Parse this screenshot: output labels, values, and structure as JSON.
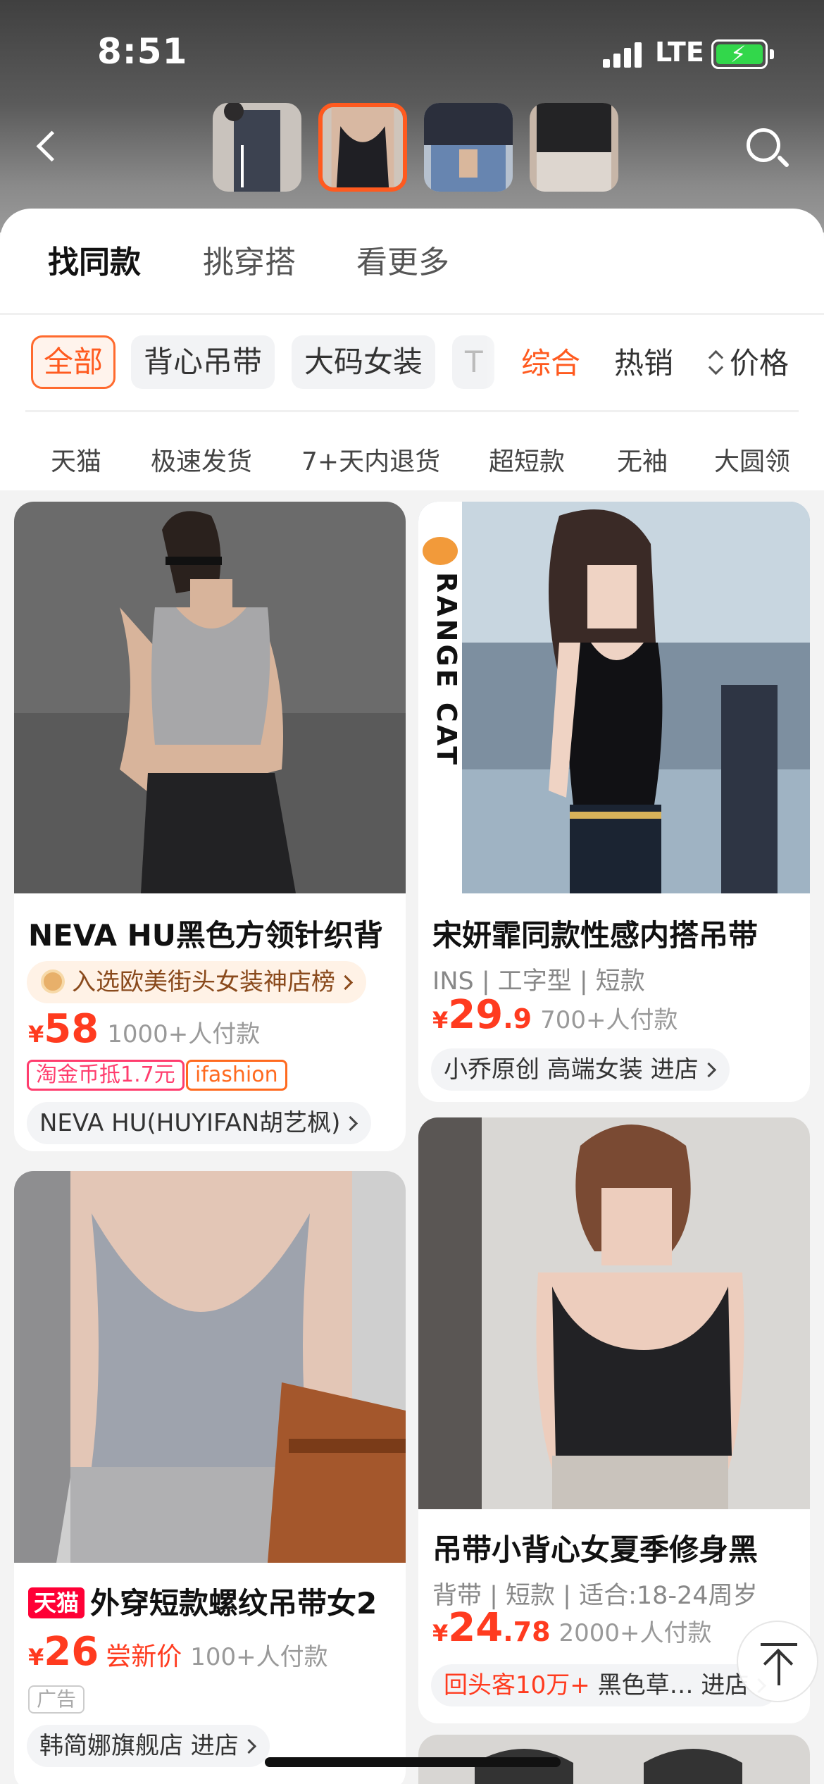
{
  "status_bar": {
    "time": "8:51",
    "network": "LTE"
  },
  "header_tabs": [
    {
      "label": "找同款",
      "active": true
    },
    {
      "label": "挑穿搭",
      "active": false
    },
    {
      "label": "看更多",
      "active": false
    }
  ],
  "category_chips": [
    {
      "label": "全部",
      "selected": true
    },
    {
      "label": "背心吊带",
      "selected": false
    },
    {
      "label": "大码女装",
      "selected": false
    },
    {
      "label": "T",
      "selected": false
    }
  ],
  "sort_options": [
    {
      "label": "综合",
      "selected": true
    },
    {
      "label": "热销",
      "selected": false
    },
    {
      "label": "价格",
      "selected": false
    }
  ],
  "filters": [
    "天猫",
    "极速发货",
    "7+天内退货",
    "超短款",
    "无袖",
    "大圆领"
  ],
  "products": [
    {
      "title": "NEVA HU黑色方领针织背",
      "rank_label": "入选欧美街头女装神店榜",
      "currency": "¥",
      "price_int": "58",
      "price_dec": "",
      "sold": "1000+人付款",
      "tags": [
        "淘金币抵1.7元",
        "ifashion"
      ],
      "shop": "NEVA HU(HUYIFAN胡艺枫)"
    },
    {
      "title": "宋妍霏同款性感内搭吊带",
      "brand_mark": "RANGE CAT",
      "meta": "INS | 工字型 | 短款",
      "currency": "¥",
      "price_int": "29",
      "price_dec": ".9",
      "sold": "700+人付款",
      "shop": "小乔原创 高端女装 进店"
    },
    {
      "tmall_badge": "天猫",
      "title": "外穿短款螺纹吊带女2",
      "currency": "¥",
      "price_int": "26",
      "price_note": "尝新价",
      "sold": "100+人付款",
      "ad_label": "广告",
      "shop": "韩简娜旗舰店 进店"
    },
    {
      "title": "吊带小背心女夏季修身黑",
      "meta": "背带 | 短款 | 适合:18-24周岁",
      "currency": "¥",
      "price_int": "24",
      "price_dec": ".78",
      "sold": "2000+人付款",
      "shop_highlight": "回头客10万+",
      "shop_rest": " 黑色草… 进店"
    }
  ],
  "colors": {
    "accent": "#ff5a1f",
    "price": "#ff3b1f",
    "tmall": "#ff0036"
  }
}
